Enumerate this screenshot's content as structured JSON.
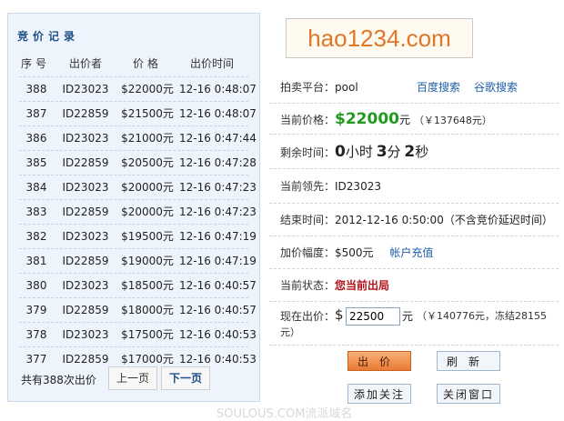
{
  "records": {
    "title": "竞价记录",
    "headers": [
      "序号",
      "出价者",
      "价格",
      "出价时间"
    ],
    "rows": [
      [
        "388",
        "ID23023",
        "$22000元",
        "12-16 0:48:07"
      ],
      [
        "387",
        "ID22859",
        "$21500元",
        "12-16 0:48:07"
      ],
      [
        "386",
        "ID23023",
        "$21000元",
        "12-16 0:47:44"
      ],
      [
        "385",
        "ID22859",
        "$20500元",
        "12-16 0:47:28"
      ],
      [
        "384",
        "ID23023",
        "$20000元",
        "12-16 0:47:23"
      ],
      [
        "383",
        "ID22859",
        "$20000元",
        "12-16 0:47:23"
      ],
      [
        "382",
        "ID23023",
        "$19500元",
        "12-16 0:47:19"
      ],
      [
        "381",
        "ID22859",
        "$19000元",
        "12-16 0:47:19"
      ],
      [
        "380",
        "ID23023",
        "$18500元",
        "12-16 0:40:57"
      ],
      [
        "379",
        "ID22859",
        "$18000元",
        "12-16 0:40:57"
      ],
      [
        "378",
        "ID23023",
        "$17500元",
        "12-16 0:40:53"
      ],
      [
        "377",
        "ID22859",
        "$17000元",
        "12-16 0:40:53"
      ]
    ],
    "total": "共有388次出价",
    "prev": "上一页",
    "next": "下一页"
  },
  "auction": {
    "logo": "hao1234.com",
    "platform_label": "拍卖平台：",
    "platform": "pool",
    "baidu": "百度搜索",
    "google": "谷歌搜索",
    "price_label": "当前价格：",
    "price": "$22000",
    "price_unit": "元",
    "price_rmb": "（￥137648元）",
    "remaining_label": "剩余时间：",
    "hours": "0",
    "hours_unit": "小时",
    "minutes": "3",
    "minutes_unit": "分",
    "seconds": "2",
    "seconds_unit": "秒",
    "leader_label": "当前领先：",
    "leader": "ID23023",
    "end_label": "结束时间：",
    "end_time": "2012-12-16 0:50:00（不含竞价延迟时间）",
    "increment_label": "加价幅度：",
    "increment": "$500元",
    "recharge": "帐户充值",
    "status_label": "当前状态：",
    "status": "您当前出局",
    "bid_label": "现在出价：",
    "bid_currency": "$",
    "bid_value": "22500",
    "bid_unit": "元",
    "bid_note1": "（￥140776元，冻结28155",
    "bid_note2": "元）",
    "btn_bid": "出价",
    "btn_refresh": "刷新",
    "btn_follow": "添加关注",
    "btn_close": "关闭窗口"
  },
  "watermark": "SOULOUS.COM流派域名"
}
